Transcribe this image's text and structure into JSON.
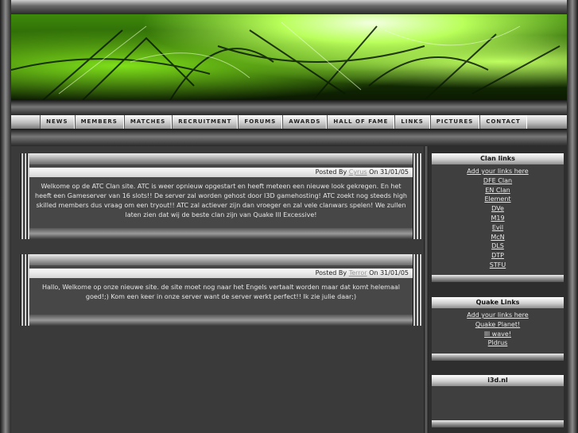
{
  "nav": {
    "items": [
      "NEWS",
      "MEMBERS",
      "MATCHES",
      "RECRUITMENT",
      "FORUMS",
      "AWARDS",
      "HALL OF FAME",
      "LINKS",
      "PICTURES",
      "CONTACT"
    ]
  },
  "posts": [
    {
      "posted_by_label": "Posted By",
      "author": "Cyrus",
      "on_label": "On",
      "date": "31/01/05",
      "body": "Welkome op de ATC Clan site. ATC is weer opnieuw opgestart en heeft meteen een nieuwe look gekregen. En het heeft een Gameserver van 16 slots!! De server zal worden gehost door I3D gamehosting! ATC zoekt nog steeds high skilled members dus vraag om een tryout!! ATC zal actiever zijn dan vroeger en zal vele clanwars spelen! We zullen laten zien dat wij de beste clan zijn van Quake III Excessive!"
    },
    {
      "posted_by_label": "Posted By",
      "author": "Terror",
      "on_label": "On",
      "date": "31/01/05",
      "body": "Hallo, Welkome op onze nieuwe site. de site moet nog naar het Engels vertaalt worden maar dat komt helemaal goed!;) Kom een keer in onze server want de server werkt perfect!! Ik zie julie daar;)"
    }
  ],
  "sidebar": {
    "clan_links": {
      "title": "Clan links",
      "items": [
        "Add your links here",
        "DFE Clan",
        "EN Clan",
        "Element",
        "DVe",
        "M19",
        "Evil",
        "McN",
        "DLS",
        "DTP",
        "STFU"
      ]
    },
    "quake_links": {
      "title": "Quake Links",
      "items": [
        "Add your links here",
        "Quake Planet!",
        "III wave!",
        "Pldrus"
      ]
    },
    "sponsor": {
      "title": "i3d.nl"
    }
  }
}
